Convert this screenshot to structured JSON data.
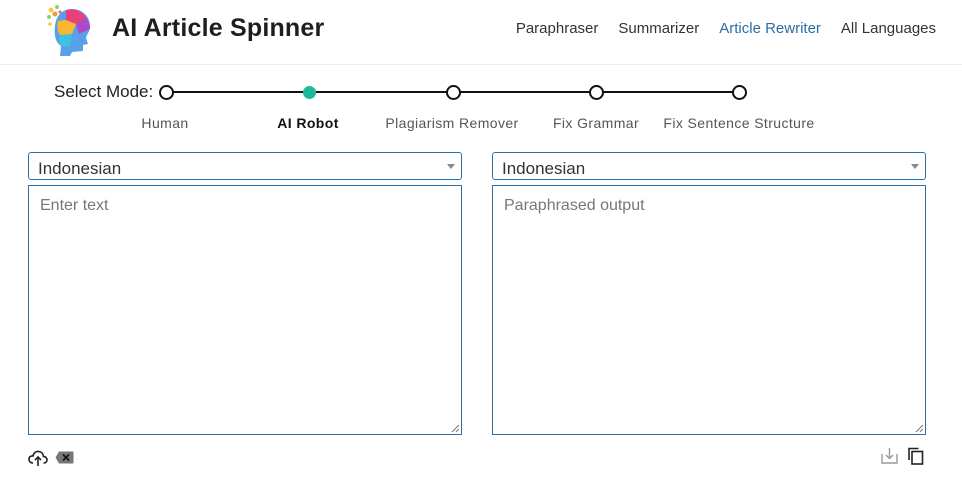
{
  "header": {
    "brand": "AI Article Spinner",
    "nav": [
      {
        "label": "Paraphraser",
        "active": false
      },
      {
        "label": "Summarizer",
        "active": false
      },
      {
        "label": "Article Rewriter",
        "active": true
      },
      {
        "label": "All Languages",
        "active": false
      }
    ]
  },
  "mode": {
    "label": "Select Mode:",
    "options": [
      {
        "label": "Human"
      },
      {
        "label": "AI Robot",
        "selected": true
      },
      {
        "label": "Plagiarism Remover"
      },
      {
        "label": "Fix Grammar"
      },
      {
        "label": "Fix Sentence Structure"
      }
    ]
  },
  "input": {
    "language": "Indonesian",
    "placeholder": "Enter text"
  },
  "output": {
    "language": "Indonesian",
    "placeholder": "Paraphrased output"
  },
  "icons": {
    "upload": "cloud-upload-icon",
    "clear": "clear-x-icon",
    "download": "download-icon",
    "copy": "copy-icon"
  },
  "colors": {
    "accent": "#2b6fa8",
    "nav_active": "#2e6ca4",
    "selected_mode": "#1eb89a"
  }
}
